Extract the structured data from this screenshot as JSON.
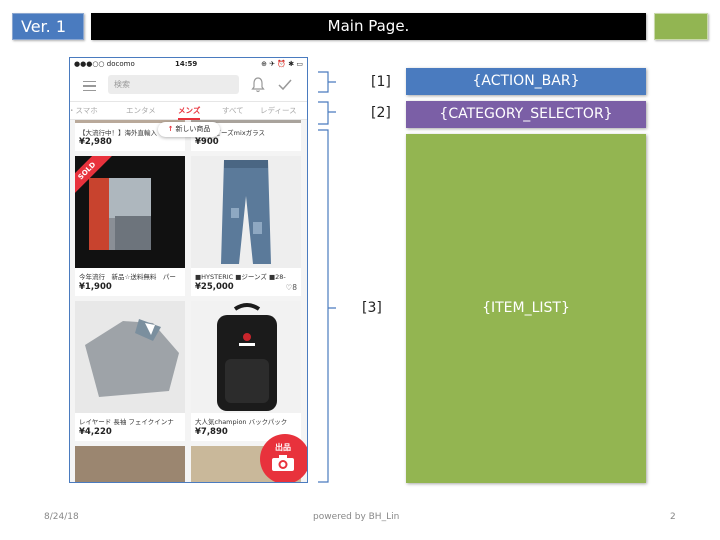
{
  "header": {
    "version": "Ver. 1",
    "title": "Main Page."
  },
  "phone": {
    "status_bar": {
      "carrier": "●●●○○ docomo",
      "time": "14:59",
      "right_icons": "⊕ ✈ ⏰ ✱ ▭"
    },
    "search_placeholder": "検索",
    "tabs": [
      "・スマホ",
      "エンタメ",
      "メンズ",
      "すべて",
      "レディース"
    ],
    "active_tab": "メンズ",
    "new_items_label": "新しい商品",
    "items": [
      {
        "name": "【大流行中！】海外直輸入",
        "price": "¥2,980"
      },
      {
        "name": "メタルビーズmixガラス",
        "price": "¥900"
      },
      {
        "name": "今年流行　新品☆送料無料　パー",
        "price": "¥1,900",
        "sold": true
      },
      {
        "name": "■HYSTERIC ■ジーンズ ■28-",
        "price": "¥25,000",
        "likes": "♡8"
      },
      {
        "name": "レイヤード 長袖 フェイクインナ",
        "price": "¥4,220"
      },
      {
        "name": "大人気champion バックパック",
        "price": "¥7,890"
      }
    ],
    "sold_label": "SOLD",
    "sell_button_label": "出品"
  },
  "callouts": {
    "one": "[1]",
    "two": "[2]",
    "three": "[3]"
  },
  "components": {
    "action_bar": "{ACTION_BAR}",
    "category_selector": "{CATEGORY_SELECTOR}",
    "item_list": "{ITEM_LIST}"
  },
  "footer": {
    "date": "8/24/18",
    "credit": "powered by BH_Lin",
    "page": "2"
  },
  "colors": {
    "action_bar": "#4a7bbf",
    "category_selector": "#7b5fa6",
    "item_list": "#93b551",
    "accent_red": "#e8323c"
  }
}
